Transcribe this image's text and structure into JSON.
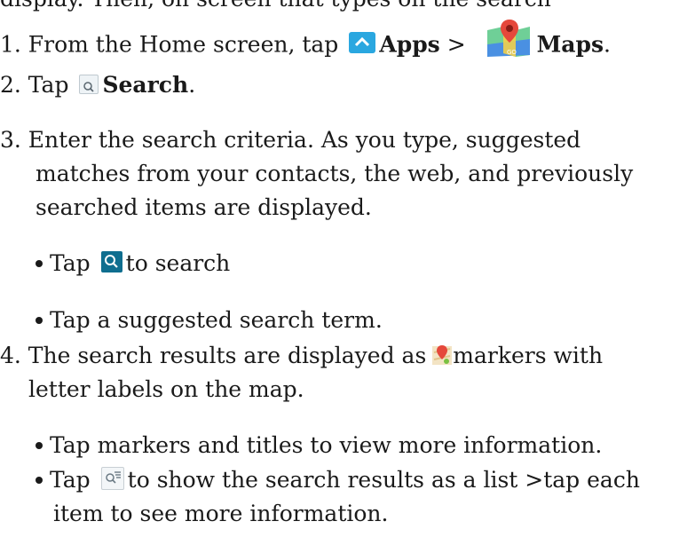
{
  "lines": {
    "top": "display. Then, on screen that types on the search",
    "s1_pre": "1. From the Home screen, tap",
    "s1_apps": "Apps",
    "s1_sep": " > ",
    "s1_maps": "Maps",
    "s1_end": ".",
    "s2_pre": "2. Tap",
    "s2_bold": "Search",
    "s2_end": ".",
    "s3_l1": "3. Enter the search criteria. As you type, suggested",
    "s3_l2": "matches from your contacts, the web, and previously",
    "s3_l3": "searched items are displayed.",
    "b1_pre": "Tap",
    "b1_post": "to search",
    "b2": "Tap a suggested search term.",
    "s4_pre": "4. The search results are displayed as",
    "s4_post": "markers with",
    "s4_l2": "letter labels on the map.",
    "b3": "Tap markers and titles to view more information.",
    "b4_pre": "Tap",
    "b4_post": "to show the search results as a list >tap each",
    "b4_l2": "item to see more information."
  },
  "icons": {
    "apps": "apps-icon",
    "maps": "maps-icon",
    "search": "search-icon",
    "search_button": "search-button-icon",
    "marker": "map-marker-icon",
    "list": "list-view-icon"
  },
  "colors": {
    "text": "#1a1a1a",
    "apps_blue": "#2aa7e0",
    "search_button": "#0f6e8f"
  }
}
